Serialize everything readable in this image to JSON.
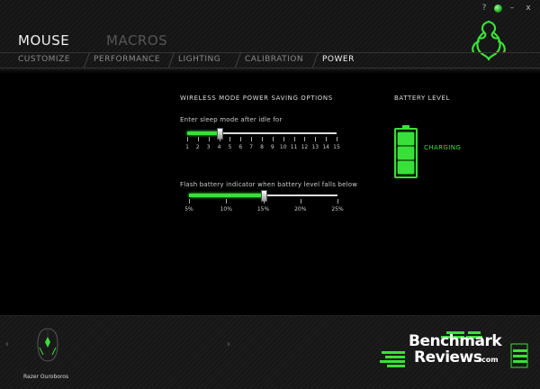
{
  "window_controls": {
    "help": "?",
    "minimize": "–",
    "close": "x"
  },
  "main_tabs": {
    "mouse": "MOUSE",
    "macros": "MACROS"
  },
  "sub_tabs": [
    "CUSTOMIZE",
    "PERFORMANCE",
    "LIGHTING",
    "CALIBRATION",
    "POWER"
  ],
  "power": {
    "section_title": "WIRELESS MODE POWER SAVING OPTIONS",
    "sleep": {
      "label": "Enter sleep mode after idle for",
      "ticks": [
        "1",
        "2",
        "3",
        "4",
        "5",
        "6",
        "7",
        "8",
        "9",
        "10",
        "11",
        "12",
        "13",
        "14",
        "15"
      ],
      "value": 4
    },
    "flash": {
      "label": "Flash battery indicator when battery level falls below",
      "ticks": [
        "5%",
        "10%",
        "15%",
        "20%",
        "25%"
      ],
      "value": 15
    }
  },
  "battery": {
    "title": "BATTERY LEVEL",
    "status": "CHARGING",
    "cells": 3,
    "color": "#3ae03a"
  },
  "device": {
    "name": "Razer Ouroboros"
  },
  "watermark": {
    "line1": "Benchmark",
    "line2": "Reviews",
    "suffix": ".com"
  }
}
